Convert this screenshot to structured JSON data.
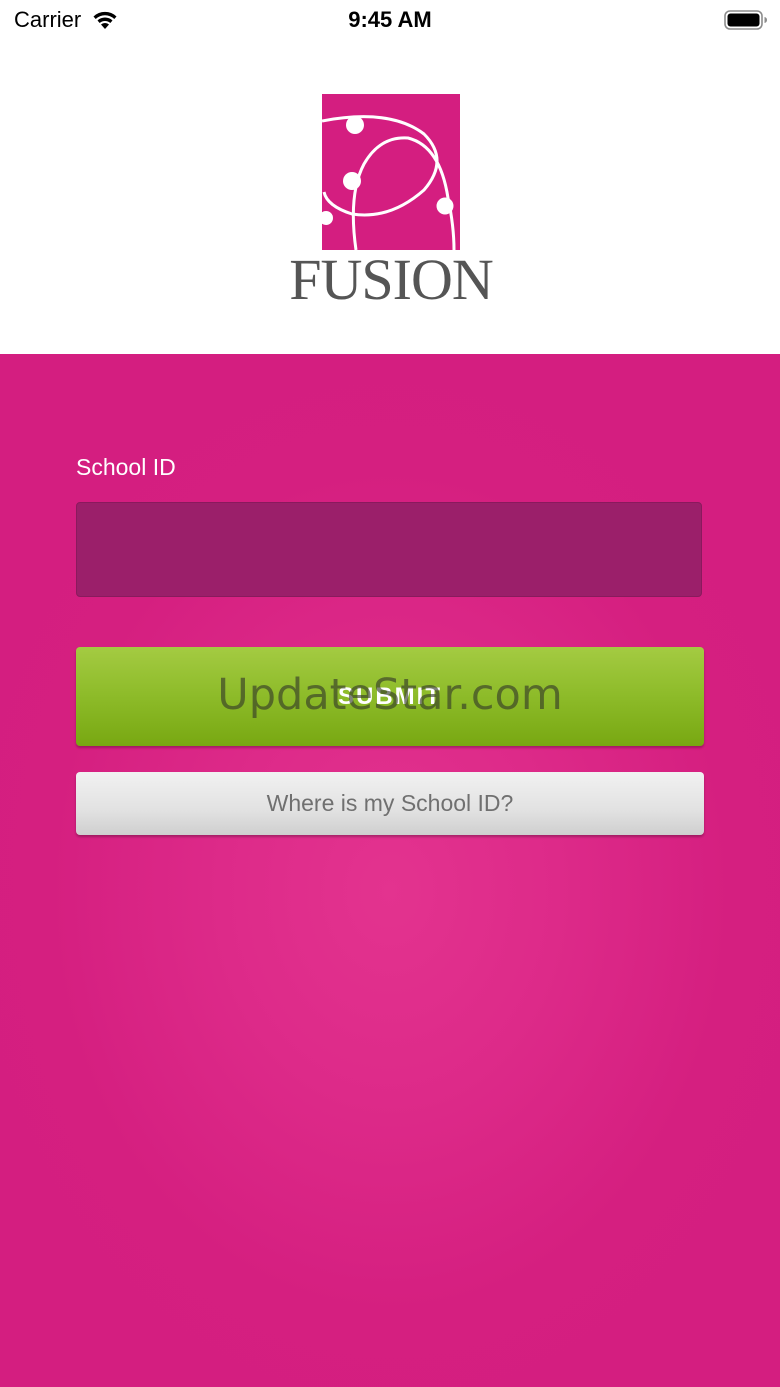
{
  "status_bar": {
    "carrier": "Carrier",
    "time": "9:45 AM",
    "wifi_icon": "wifi-icon",
    "battery_icon": "battery-icon"
  },
  "header": {
    "logo_text": "FUSION",
    "logo_icon": "fusion-orbit-logo",
    "logo_color": "#d41e80"
  },
  "form": {
    "school_id_label": "School ID",
    "school_id_value": "",
    "submit_label": "SUBMIT",
    "help_label": "Where is my School ID?"
  },
  "watermark": "UpdateStar.com",
  "colors": {
    "background": "#d41e80",
    "input_fill": "#9b1f6a",
    "submit_green": "#8dbb29",
    "help_gray": "#e2e2e2"
  }
}
